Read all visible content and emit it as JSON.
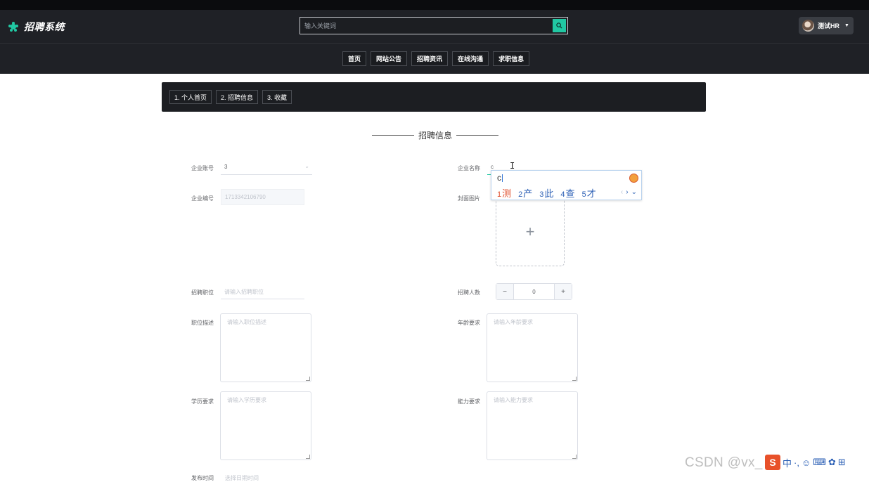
{
  "header": {
    "app_title": "招聘系统",
    "search_placeholder": "输入关键词",
    "user_name": "测试HR"
  },
  "nav": [
    "首页",
    "网站公告",
    "招聘资讯",
    "在线沟通",
    "求职信息"
  ],
  "subnav": [
    "1. 个人首页",
    "2. 招聘信息",
    "3. 收藏"
  ],
  "section_title": "招聘信息",
  "form": {
    "company_account_label": "企业账号",
    "company_account_value": "3",
    "company_name_label": "企业名称",
    "company_name_value": "c",
    "company_code_label": "企业编号",
    "company_code_value": "1713342106790",
    "cover_label": "封面图片",
    "upload_plus": "+",
    "position_label": "招聘职位",
    "position_placeholder": "请输入招聘职位",
    "headcount_label": "招聘人数",
    "headcount_value": "0",
    "minus": "−",
    "plus": "+",
    "desc_label": "职位描述",
    "desc_placeholder": "请输入职位描述",
    "age_label": "年龄要求",
    "age_placeholder": "请输入年龄要求",
    "edu_label": "学历要求",
    "edu_placeholder": "请输入学历要求",
    "ability_label": "能力要求",
    "ability_placeholder": "请输入能力要求",
    "publish_label": "发布时间",
    "publish_placeholder": "选择日期时间"
  },
  "ime": {
    "composition": "c",
    "candidates": [
      {
        "num": "1",
        "text": "测"
      },
      {
        "num": "2",
        "text": "产"
      },
      {
        "num": "3",
        "text": "此"
      },
      {
        "num": "4",
        "text": "查"
      },
      {
        "num": "5",
        "text": "才"
      }
    ]
  },
  "watermark": "CSDN @vx_"
}
